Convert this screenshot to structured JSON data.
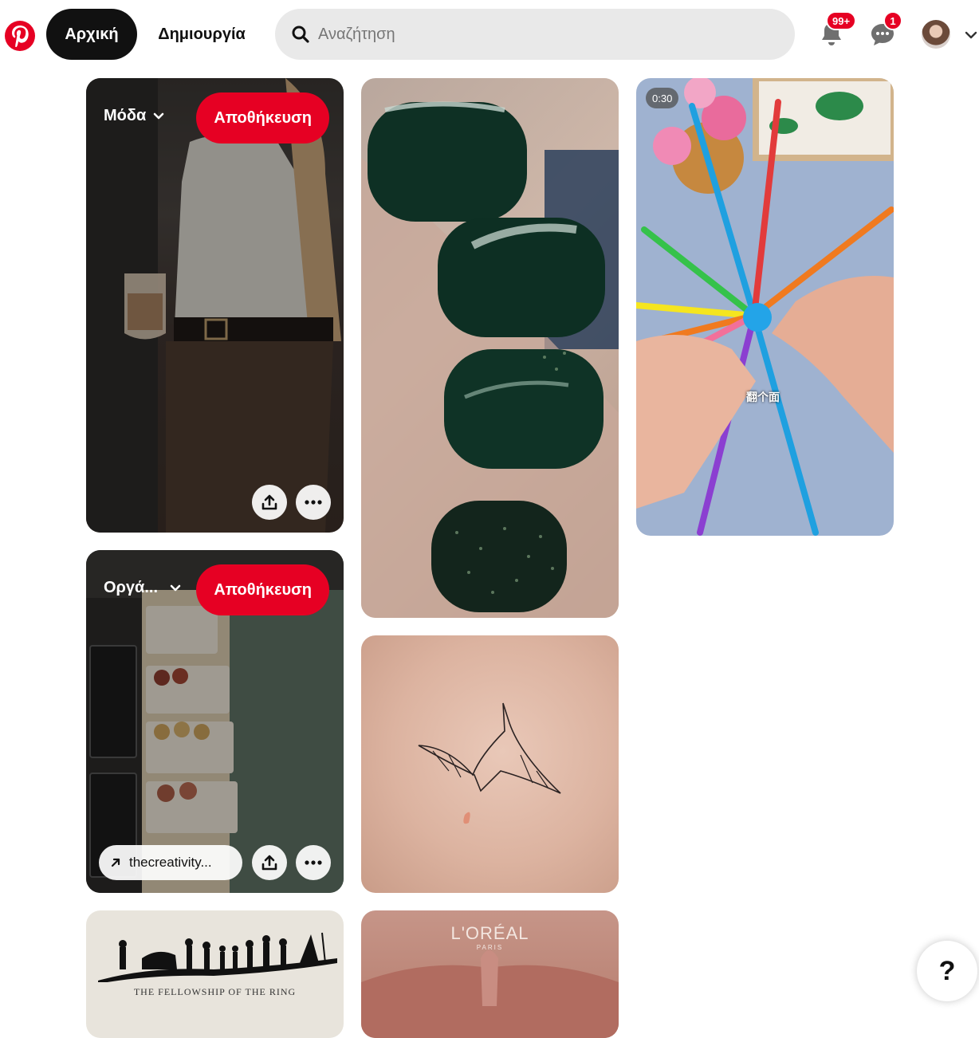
{
  "header": {
    "home_label": "Αρχική",
    "create_label": "Δημιουργία",
    "search_placeholder": "Αναζήτηση",
    "notifications_badge": "99+",
    "messages_badge": "1"
  },
  "pins": [
    {
      "board": "Μόδα",
      "save_label": "Αποθήκευση"
    },
    {
      "board": "Οργά...",
      "save_label": "Αποθήκευση",
      "link_label": "thecreativity..."
    },
    {
      "caption": "THE FELLOWSHIP OF THE RING"
    },
    {
      "brand": "L'ORÉAL",
      "brand_sub": "PARIS"
    },
    {
      "video_duration": "0:30",
      "overlay_text": "翻个面"
    }
  ],
  "help_label": "?",
  "colors": {
    "brand_red": "#e60023",
    "nav_active_bg": "#111111",
    "search_bg": "#e9e9e9"
  },
  "icons": {
    "logo": "pinterest-logo-icon",
    "search": "search-icon",
    "notifications": "bell-icon",
    "messages": "chat-bubble-icon",
    "share": "share-icon",
    "more": "more-dots-icon",
    "link": "arrow-up-right-icon",
    "chevron": "chevron-down-icon"
  }
}
